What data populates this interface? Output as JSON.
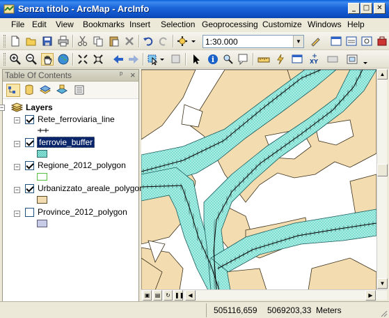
{
  "window": {
    "title": "Senza titolo - ArcMap - ArcInfo",
    "minimize": "_",
    "maximize": "□",
    "close": "✕"
  },
  "menu": [
    "File",
    "Edit",
    "View",
    "Bookmarks",
    "Insert",
    "Selection",
    "Geoprocessing",
    "Customize",
    "Windows",
    "Help"
  ],
  "toolbar": {
    "scale_value": "1:30.000"
  },
  "toc": {
    "title": "Table Of Contents",
    "pin": "ᵖ",
    "close": "×",
    "root": "Layers",
    "layers": [
      {
        "name": "Rete_ferroviaria_line",
        "checked": true,
        "selected": false,
        "symbol": "railway-line"
      },
      {
        "name": "ferrovie_buffer",
        "checked": true,
        "selected": true,
        "symbol": "cyan-hatch-fill"
      },
      {
        "name": "Regione_2012_polygon",
        "checked": true,
        "selected": false,
        "symbol": "green-outline"
      },
      {
        "name": "Urbanizzato_areale_polygon",
        "checked": true,
        "selected": false,
        "symbol": "tan-fill"
      },
      {
        "name": "Province_2012_polygon",
        "checked": false,
        "selected": false,
        "symbol": "lavender-fill"
      }
    ]
  },
  "status": {
    "x": "505116,659",
    "y": "5069203,33",
    "units": "Meters"
  },
  "colors": {
    "titlebar": "#0d4fc4",
    "selection": "#0a246a",
    "urban": "#f2dcb0",
    "buffer": "#8ee6da"
  }
}
